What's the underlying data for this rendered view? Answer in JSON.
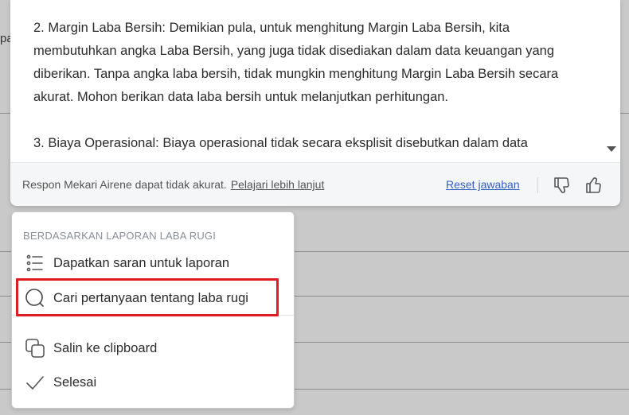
{
  "background": {
    "partial_text": "pa"
  },
  "response": {
    "paragraphs": [
      "2. Margin Laba Bersih: Demikian pula, untuk menghitung Margin Laba Bersih, kita membutuhkan angka Laba Bersih, yang juga tidak disediakan dalam data keuangan yang diberikan. Tanpa angka laba bersih, tidak mungkin menghitung Margin Laba Bersih secara akurat. Mohon berikan data laba bersih untuk melanjutkan perhitungan.",
      "3. Biaya Operasional: Biaya operasional tidak secara eksplisit disebutkan dalam data"
    ]
  },
  "footer": {
    "disclaimer": "Respon Mekari Airene dapat tidak akurat.",
    "learn_more": "Pelajari lebih lanjut",
    "reset": "Reset jawaban",
    "thumbs_down_icon": "thumbs-down-icon",
    "thumbs_up_icon": "thumbs-up-icon"
  },
  "menu": {
    "header": "BERDASARKAN LAPORAN LABA RUGI",
    "items": [
      {
        "label": "Dapatkan saran untuk laporan",
        "icon": "list-icon"
      },
      {
        "label": "Cari pertanyaan tentang laba rugi",
        "icon": "search-icon"
      },
      {
        "label": "Salin ke clipboard",
        "icon": "copy-icon"
      },
      {
        "label": "Selesai",
        "icon": "check-icon"
      }
    ],
    "highlight_color": "#e11b22"
  },
  "colors": {
    "link": "#2f5fc4",
    "text": "#2b2b2b"
  }
}
